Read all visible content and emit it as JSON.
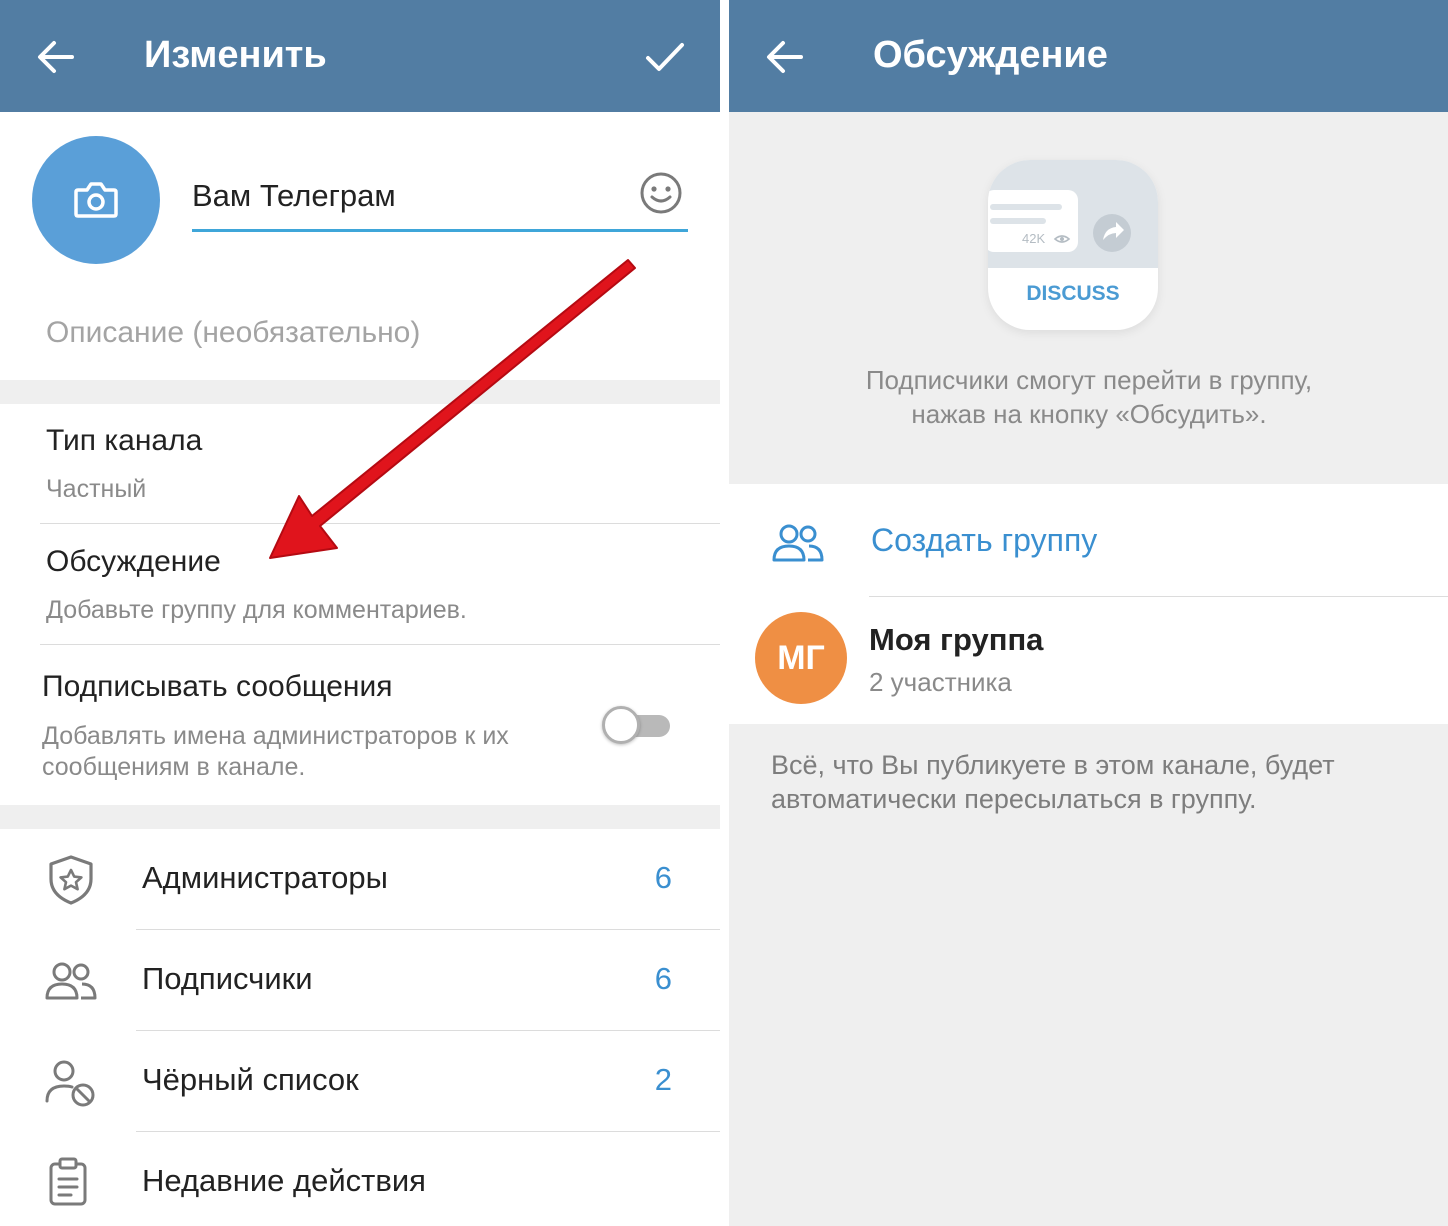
{
  "left": {
    "appbar": {
      "title": "Изменить",
      "back_icon": "arrow-left-icon",
      "confirm_icon": "check-icon"
    },
    "channel": {
      "name": "Вам Телеграм",
      "photo_icon": "camera-icon",
      "emoji_icon": "smile-icon"
    },
    "description": {
      "placeholder": "Описание (необязательно)"
    },
    "settings": {
      "channel_type": {
        "title": "Тип канала",
        "value": "Частный"
      },
      "discussion": {
        "title": "Обсуждение",
        "value": "Добавьте группу для комментариев."
      },
      "sign_messages": {
        "title": "Подписывать сообщения",
        "value": "Добавлять имена администраторов к их сообщениям в канале.",
        "enabled": false
      }
    },
    "menu": [
      {
        "label": "Администраторы",
        "count": "6",
        "icon": "shield-star-icon"
      },
      {
        "label": "Подписчики",
        "count": "6",
        "icon": "users-icon"
      },
      {
        "label": "Чёрный список",
        "count": "2",
        "icon": "user-blocked-icon"
      },
      {
        "label": "Недавние действия",
        "count": "",
        "icon": "clipboard-icon"
      }
    ],
    "annotation": {
      "type": "red-arrow",
      "points_to": "discussion"
    },
    "colors": {
      "header": "#527da3",
      "accent": "#3a8fd0",
      "avatar": "#5a9fd8",
      "arrow": "#e0141c"
    }
  },
  "right": {
    "appbar": {
      "title": "Обсуждение",
      "back_icon": "arrow-left-icon"
    },
    "illustration": {
      "views": "42K",
      "button": "DISCUSS",
      "share_icon": "share-icon",
      "eye_icon": "eye-icon"
    },
    "hint_line1": "Подписчики смогут перейти в группу,",
    "hint_line2": "нажав на кнопку «Обсудить».",
    "create_group": {
      "label": "Создать группу",
      "icon": "users-icon"
    },
    "group": {
      "initials": "МГ",
      "name": "Моя группа",
      "members": "2 участника",
      "avatar_color": "#ef8f44"
    },
    "footer": "Всё, что Вы публикуете в этом канале, будет автоматически пересылаться в группу."
  }
}
